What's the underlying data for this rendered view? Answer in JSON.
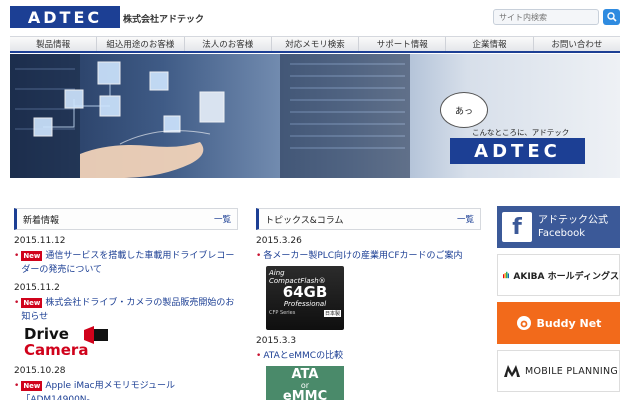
{
  "header": {
    "logo_text": "ADTEC",
    "company": "株式会社アドテック",
    "search_placeholder": "サイト内検索"
  },
  "nav": [
    "製品情報",
    "組込用途のお客様",
    "法人のお客様",
    "対応メモリ検索",
    "サポート情報",
    "企業情報",
    "お問い合わせ"
  ],
  "hero": {
    "bubble": "あっ",
    "tagline": "こんなところに、アドテック",
    "logo_text": "ADTEC"
  },
  "news": {
    "title": "新着情報",
    "more": "一覧",
    "items": [
      {
        "date": "2015.11.12",
        "new": "New",
        "text": "通信サービスを搭載した車載用ドライブレコーダーの発売について"
      },
      {
        "date": "2015.11.2",
        "new": "New",
        "text": "株式会社ドライブ・カメラの製品販売開始のお知らせ",
        "image_text": [
          "Drive",
          "Camera"
        ]
      },
      {
        "date": "2015.10.28",
        "new": "New",
        "text": "Apple iMac用メモリモジュール「ADM14900N-"
      }
    ]
  },
  "topics": {
    "title": "トピックス&コラム",
    "more": "一覧",
    "items": [
      {
        "date": "2015.3.26",
        "text": "各メーカー製PLC向けの産業用CFカードのご案内",
        "card": {
          "brand": "Aing",
          "line1": "CompactFlash®",
          "capacity": "64GB",
          "line2": "Professional",
          "series": "CFP Series",
          "region": "日本製"
        }
      },
      {
        "date": "2015.3.3",
        "text": "ATAとeMMCの比較",
        "card_text": [
          "ATA",
          "or",
          "eMMC"
        ]
      }
    ]
  },
  "banners": [
    {
      "icon": "f",
      "text": "アドテック公式\nFacebook",
      "color": "#3b5998"
    },
    {
      "text": "AKIBA ホールディングス",
      "color": "#ffffff"
    },
    {
      "text": "Buddy Net",
      "color": "#f26a1b"
    },
    {
      "text": "MOBILE PLANNING",
      "color": "#ffffff"
    }
  ],
  "colors": {
    "brand": "#1c3f94",
    "new_badge": "#d0021b",
    "search_button": "#2f8be0"
  }
}
